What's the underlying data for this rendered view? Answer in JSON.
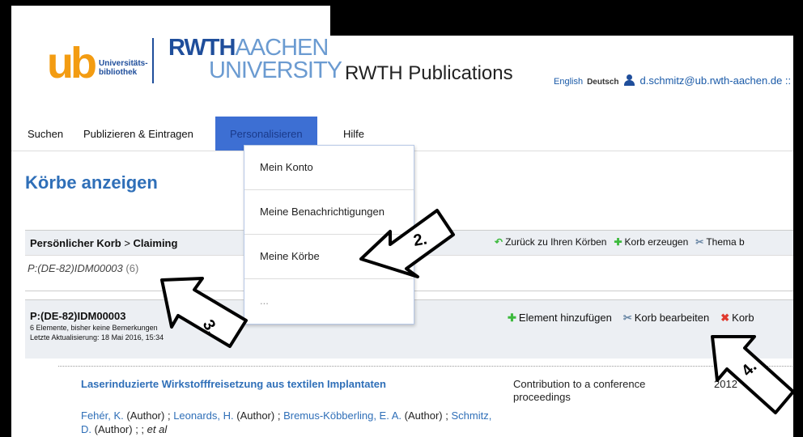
{
  "header": {
    "ub_logo": "ub",
    "ub_logo_sub_1": "Universitäts-",
    "ub_logo_sub_2": "bibliothek",
    "rwth_logo_line1_bold": "RWTH",
    "rwth_logo_line1_light": "AACHEN",
    "rwth_logo_line2": "UNIVERSITY",
    "site_title": "RWTH Publications",
    "lang_english": "English",
    "lang_deutsch": "Deutsch",
    "user_email": "d.schmitz@ub.rwth-aachen.de ::"
  },
  "nav": {
    "items": [
      {
        "label": "Suchen"
      },
      {
        "label": "Publizieren & Eintragen"
      },
      {
        "label": "Personalisieren"
      },
      {
        "label": "Hilfe"
      }
    ]
  },
  "dropdown": {
    "items": [
      {
        "label": "Mein Konto"
      },
      {
        "label": "Meine Benachrichtigungen"
      },
      {
        "label": "Meine Körbe"
      },
      {
        "label": "..."
      }
    ]
  },
  "main": {
    "page_title": "Körbe anzeigen",
    "basket_path_prefix": "Persönlicher Korb",
    "basket_path_sep": ">",
    "basket_path_name": "Claiming",
    "bar_actions": {
      "back": "Zurück zu Ihren Körben",
      "create": "Korb erzeugen",
      "topic": "Thema b"
    },
    "basket_id": "P:(DE-82)IDM00003",
    "basket_count": "(6)",
    "box": {
      "title": "P:(DE-82)IDM00003",
      "info": "6 Elemente, bisher keine Bemerkungen",
      "updated": "Letzte Aktualisierung: 18 Mai 2016, 15:34",
      "add": "Element hinzufügen",
      "edit": "Korb bearbeiten",
      "delete": "Korb"
    },
    "entry": {
      "title": "Laserinduzierte Wirkstofffreisetzung aus textilen Implantaten",
      "type": "Contribution to a conference proceedings",
      "year": "2012",
      "authors": [
        {
          "name": "Fehér, K.",
          "role": "(Author) ;"
        },
        {
          "name": "Leonards, H.",
          "role": "(Author) ;"
        },
        {
          "name": "Bremus-Köbberling, E. A.",
          "role": "(Author) ;"
        },
        {
          "name": "Schmitz, D.",
          "role": "(Author) ; ;"
        }
      ],
      "et_al": "et al"
    }
  },
  "annotations": {
    "arrow_2": "2.",
    "arrow_3": "3.",
    "arrow_4": "4."
  }
}
